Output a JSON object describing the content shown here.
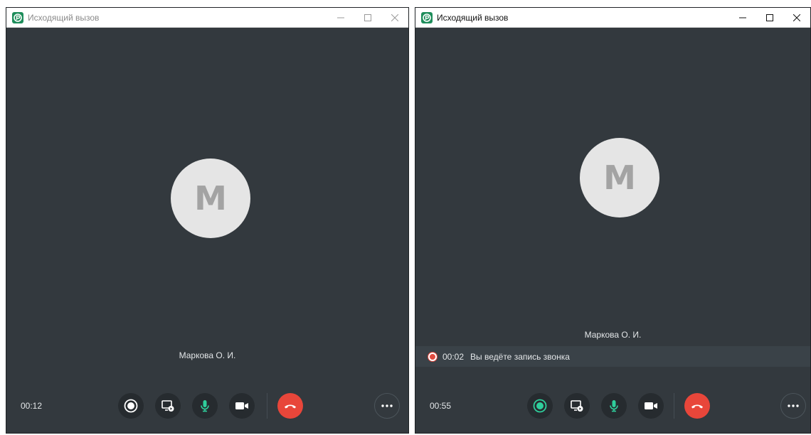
{
  "windows": [
    {
      "state": "inactive",
      "title": "Исходящий вызов",
      "avatar_letter": "M",
      "contact_name": "Маркова О. И.",
      "call_timer": "00:12",
      "recording": false
    },
    {
      "state": "active",
      "title": "Исходящий вызов",
      "avatar_letter": "M",
      "contact_name": "Маркова О. И.",
      "call_timer": "00:55",
      "recording": true,
      "recording_banner": {
        "elapsed": "00:02",
        "text": "Вы ведёте запись звонка"
      }
    }
  ],
  "icons": {
    "app": "app-logo-icon",
    "record": "record-icon",
    "screen_share": "screen-share-icon",
    "microphone": "microphone-icon",
    "camera": "camera-icon",
    "end_call": "end-call-icon",
    "more": "more-icon",
    "minimize": "minimize-icon",
    "maximize": "maximize-icon",
    "close": "close-icon"
  },
  "colors": {
    "background": "#33393e",
    "control_button": "#262b2f",
    "accent_green": "#2fcf9c",
    "end_call_red": "#e8463a",
    "recording_red": "#e04a3f",
    "avatar_bg": "#e5e5e5"
  }
}
